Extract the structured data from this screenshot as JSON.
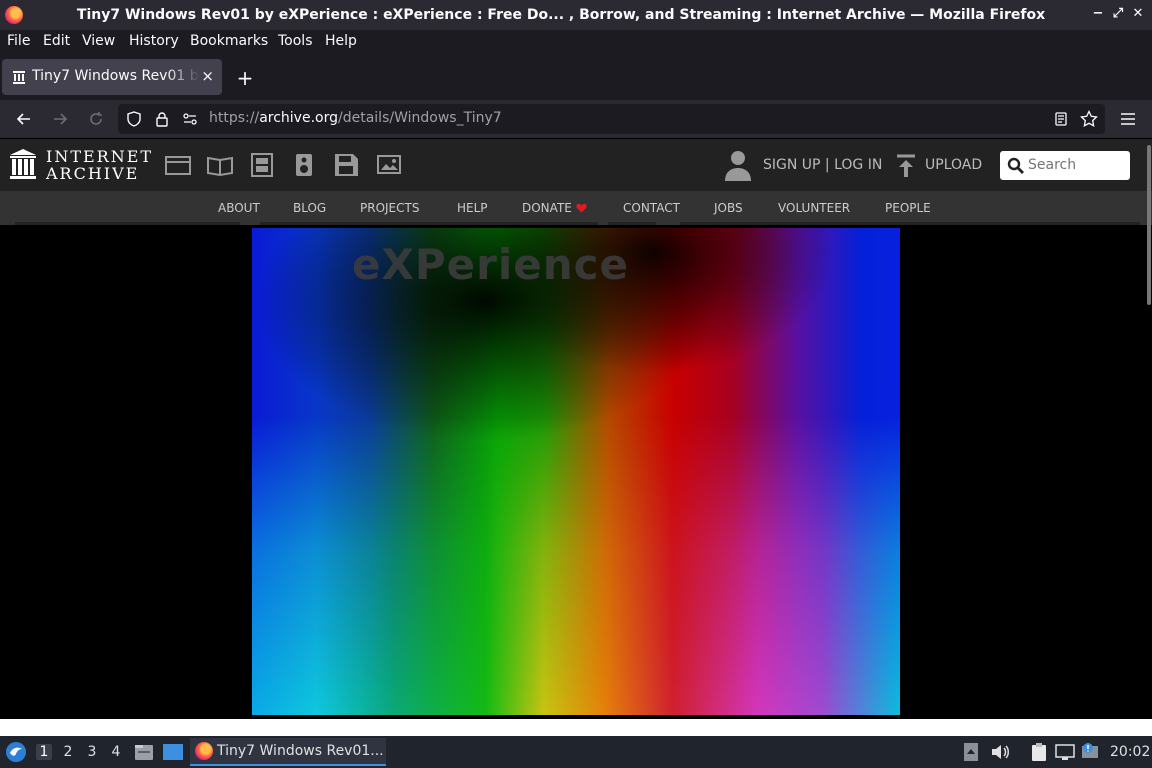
{
  "window": {
    "title": "Tiny7 Windows Rev01 by eXPerience : eXPerience : Free Do... , Borrow, and Streaming : Internet Archive — Mozilla Firefox",
    "controls": [
      "−",
      "⤢",
      "✕"
    ]
  },
  "menubar": [
    "File",
    "Edit",
    "View",
    "History",
    "Bookmarks",
    "Tools",
    "Help"
  ],
  "tab": {
    "label": "Tiny7 Windows Rev01 by eXPerience",
    "close": "×"
  },
  "newtab": "+",
  "nav": {
    "url_prefix": "https://",
    "url_domain": "archive.org",
    "url_path": "/details/Windows_Tiny7"
  },
  "ia": {
    "logo_line1": "INTERNET",
    "logo_line2": "ARCHIVE",
    "signup": "SIGN UP | LOG IN",
    "upload": "UPLOAD",
    "search_placeholder": "Search",
    "nav_items": [
      "ABOUT",
      "BLOG",
      "PROJECTS",
      "HELP",
      "DONATE",
      "CONTACT",
      "JOBS",
      "VOLUNTEER",
      "PEOPLE"
    ],
    "donate_heart_color": "#e01b24"
  },
  "cover": {
    "title": "eXPerience"
  },
  "taskbar": {
    "workspaces": [
      "1",
      "2",
      "3",
      "4"
    ],
    "active_workspace": "1",
    "task_label": "Tiny7 Windows Rev01...",
    "clock": "20:02"
  }
}
